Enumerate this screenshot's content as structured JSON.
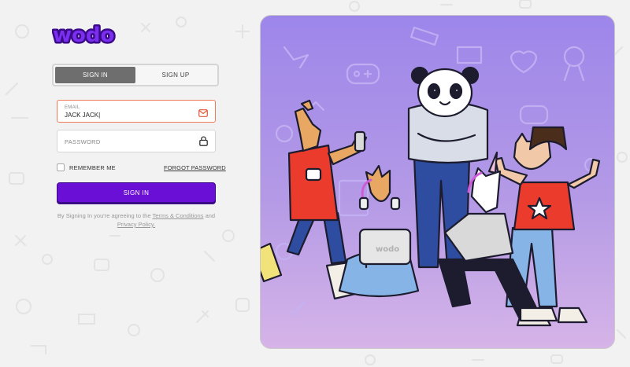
{
  "brand": {
    "logo_text": "wodo",
    "accent": "#6a0fd6",
    "focus_color": "#ef7a5a"
  },
  "tabs": [
    {
      "label": "SIGN IN",
      "active": true
    },
    {
      "label": "SIGN UP",
      "active": false
    }
  ],
  "email": {
    "label": "EMAIL",
    "value": "JACK JACK|",
    "icon": "mail-icon"
  },
  "password": {
    "placeholder": "PASSWORD",
    "icon": "lock-icon"
  },
  "remember": {
    "label": "REMEMBER ME",
    "checked": false
  },
  "forgot": {
    "label": "FORGOT PASSWORD"
  },
  "submit": {
    "label": "SIGN IN"
  },
  "terms": {
    "prefix": "By Signing In you're agreeing to the ",
    "terms_link": "Terms & Conditions",
    "middle": " and ",
    "privacy_link": "Privacy Policy."
  },
  "hero": {
    "laptop_text": "wodo"
  }
}
